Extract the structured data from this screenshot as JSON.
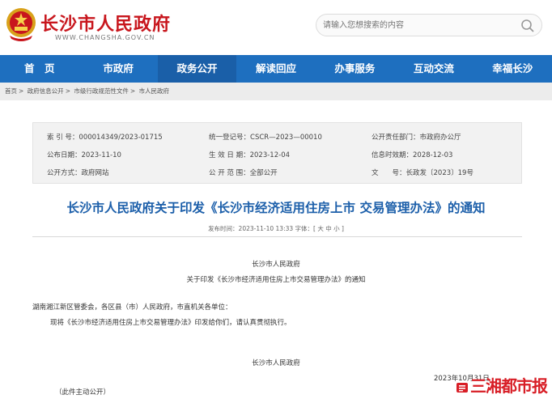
{
  "header": {
    "site_title": "长沙市人民政府",
    "site_url": "WWW.CHANGSHA.GOV.CN",
    "search_placeholder": "请输入您想搜索的内容"
  },
  "nav": [
    "首　页",
    "市政府",
    "政务公开",
    "解读回应",
    "办事服务",
    "互动交流",
    "幸福长沙"
  ],
  "breadcrumb": [
    "首页",
    "政府信息公开",
    "市级行政规范性文件",
    "市人民政府"
  ],
  "meta": {
    "index_no_label": "索 引 号：",
    "index_no": "000014349/2023-01715",
    "unified_no_label": "统一登记号：",
    "unified_no": "CSCR—2023—00010",
    "responsible_label": "公开责任部门：",
    "responsible": "市政府办公厅",
    "issue_date_label": "公布日期：",
    "issue_date": "2023-11-10",
    "effective_date_label": "生 效 日 期：",
    "effective_date": "2023-12-04",
    "expiry_date_label": "信息时效期：",
    "expiry_date": "2028-12-03",
    "disclosure_label": "公开方式：",
    "disclosure": "政府网站",
    "scope_label": "公 开 范 围：",
    "scope": "全部公开",
    "doc_no_label": "文　　号：",
    "doc_no": "长政发〔2023〕19号"
  },
  "article": {
    "title": "长沙市人民政府关于印发《长沙市经济适用住房上市 交易管理办法》的通知",
    "pubinfo": "发布时间：2023-11-10 13:33   字体：[ 大 中 小 ]",
    "issuer_top": "长沙市人民政府",
    "subtitle": "关于印发《长沙市经济适用住房上市交易管理办法》的通知",
    "addressees": "湖南湘江新区管委会，各区县（市）人民政府，市直机关各单位：",
    "body": "现将《长沙市经济适用住房上市交易管理办法》印发给你们，请认真贯彻执行。",
    "signature": "长沙市人民政府",
    "sign_date": "2023年10月31日",
    "disclosure_note": "（此件主动公开）"
  },
  "watermark": "三湘都市报",
  "colors": {
    "brand_red": "#c8161d",
    "nav_blue": "#1e6fbf",
    "title_blue": "#1c5faa"
  }
}
